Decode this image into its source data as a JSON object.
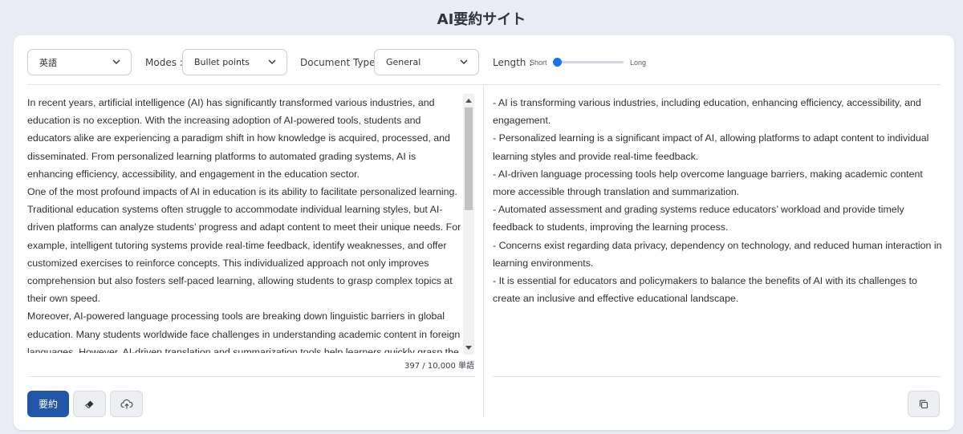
{
  "page_title": "AI要約サイト",
  "toolbar": {
    "language_select": "英語",
    "modes_label": "Modes :",
    "modes_select": "Bullet points",
    "doc_type_label": "Document Type :",
    "doc_type_select": "General",
    "length_label": "Length :",
    "length_short": "Short",
    "length_long": "Long",
    "length_value_percent": 0
  },
  "input": {
    "paragraphs": [
      "In recent years, artificial intelligence (AI) has significantly transformed various industries, and education is no exception. With the increasing adoption of AI-powered tools, students and educators alike are experiencing a paradigm shift in how knowledge is acquired, processed, and disseminated. From personalized learning platforms to automated grading systems, AI is enhancing efficiency, accessibility, and engagement in the education sector.",
      "One of the most profound impacts of AI in education is its ability to facilitate personalized learning. Traditional education systems often struggle to accommodate individual learning styles, but AI-driven platforms can analyze students’ progress and adapt content to meet their unique needs. For example, intelligent tutoring systems provide real-time feedback, identify weaknesses, and offer customized exercises to reinforce concepts. This individualized approach not only improves comprehension but also fosters self-paced learning, allowing students to grasp complex topics at their own speed.",
      "Moreover, AI-powered language processing tools are breaking down linguistic barriers in global education. Many students worldwide face challenges in understanding academic content in foreign languages. However, AI-driven translation and summarization tools help learners quickly grasp the key points of extensive texts. Tools like Wordvice AI summarize lengthy research papers, essays, and articles"
    ],
    "word_count": "397 / 10,000 単語"
  },
  "output": {
    "bullets": [
      "- AI is transforming various industries, including education, enhancing efficiency, accessibility, and engagement.",
      "- Personalized learning is a significant impact of AI, allowing platforms to adapt content to individual learning styles and provide real-time feedback.",
      "- AI-driven language processing tools help overcome language barriers, making academic content more accessible through translation and summarization.",
      "- Automated assessment and grading systems reduce educators’ workload and provide timely feedback to students, improving the learning process.",
      "- Concerns exist regarding data privacy, dependency on technology, and reduced human interaction in learning environments.",
      "- It is essential for educators and policymakers to balance the benefits of AI with its challenges to create an inclusive and effective educational landscape."
    ]
  },
  "buttons": {
    "summarize": "要約"
  },
  "icons": {
    "chevron": "chevron-down-icon",
    "eraser": "eraser-icon",
    "upload": "cloud-upload-icon",
    "copy": "copy-icon"
  },
  "colors": {
    "primary": "#2456a8",
    "slider": "#1a73e8"
  }
}
